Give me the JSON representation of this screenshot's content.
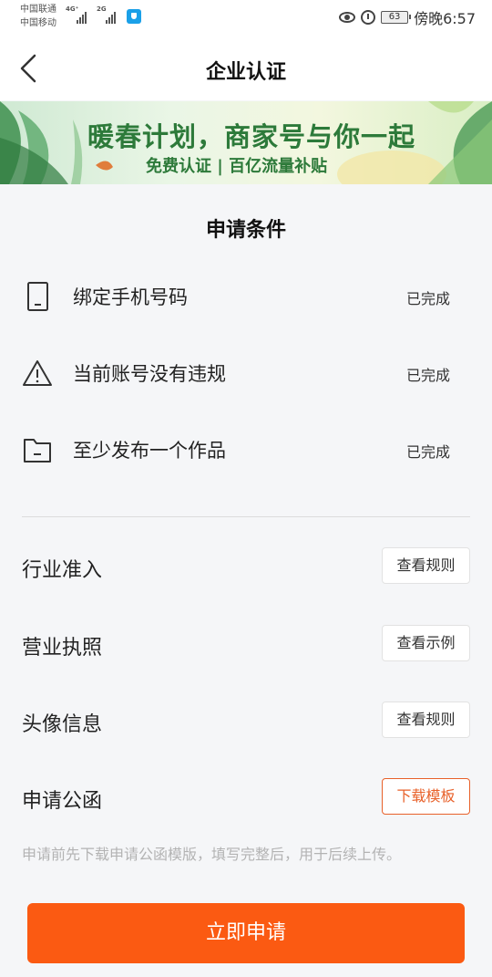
{
  "status_bar": {
    "carrier1": "中国联通",
    "carrier2": "中国移动",
    "net1": "4G⁺",
    "net2": "2G",
    "battery": "63",
    "time": "傍晚6:57",
    "icons": [
      "signal-icon",
      "vpn-shield-icon",
      "eye-icon",
      "alarm-icon",
      "battery-icon"
    ]
  },
  "header": {
    "back_icon": "back-arrow-icon",
    "title": "企业认证"
  },
  "banner": {
    "title": "暖春计划，商家号与你一起",
    "subtitle": "免费认证 | 百亿流量补贴",
    "colors": {
      "text": "#2d7a3a"
    }
  },
  "conditions": {
    "title": "申请条件",
    "items": [
      {
        "icon": "phone-icon",
        "label": "绑定手机号码",
        "status": "已完成"
      },
      {
        "icon": "warning-icon",
        "label": "当前账号没有违规",
        "status": "已完成"
      },
      {
        "icon": "folder-icon",
        "label": "至少发布一个作品",
        "status": "已完成"
      }
    ]
  },
  "requirements": [
    {
      "label": "行业准入",
      "button": "查看规则"
    },
    {
      "label": "营业执照",
      "button": "查看示例"
    },
    {
      "label": "头像信息",
      "button": "查看规则"
    },
    {
      "label": "申请公函",
      "button": "下载模板"
    }
  ],
  "hint": "申请前先下载申请公函模版，填写完整后，用于后续上传。",
  "apply_button": "立即申请",
  "colors": {
    "accent": "#fb5a12",
    "accent_outline": "#e8612a",
    "background": "#f5f6f8"
  }
}
